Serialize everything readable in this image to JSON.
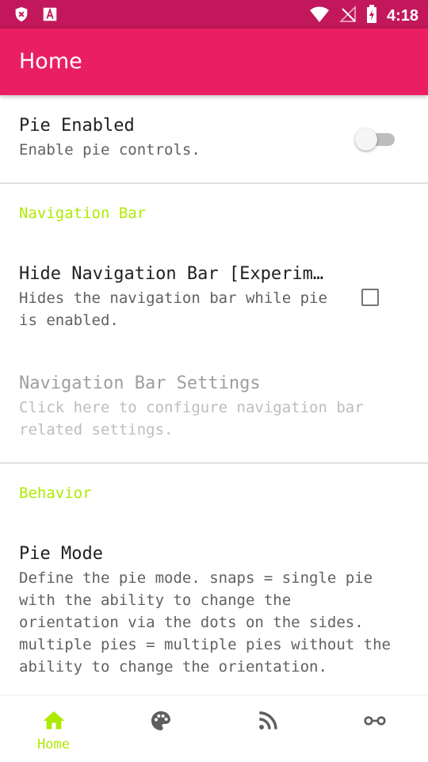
{
  "status_bar": {
    "time": "4:18",
    "left_icons": [
      "shield-x-icon",
      "a-box-icon"
    ],
    "right_icons": [
      "wifi-icon",
      "no-signal-icon",
      "battery-charging-icon"
    ]
  },
  "app_bar": {
    "title": "Home"
  },
  "preferences": {
    "pie_enabled": {
      "title": "Pie Enabled",
      "summary": "Enable pie controls.",
      "checked": false
    },
    "navigation_category": "Navigation Bar",
    "hide_nav_bar": {
      "title": "Hide Navigation Bar [Experimental]",
      "summary": "Hides the navigation bar while pie is enabled.",
      "checked": false
    },
    "nav_bar_settings": {
      "title": "Navigation Bar Settings",
      "summary": "Click here to configure navigation bar related settings.",
      "enabled": false
    },
    "behavior_category": "Behavior",
    "pie_mode": {
      "title": "Pie Mode",
      "summary": "Define the pie mode. snaps = single pie with the ability to change the orientation via the dots on the sides. multiple pies = multiple pies without the ability to change the orientation."
    }
  },
  "bottom_nav": {
    "items": [
      {
        "label": "Home",
        "icon": "home-icon",
        "selected": true
      },
      {
        "label": "",
        "icon": "palette-icon",
        "selected": false
      },
      {
        "label": "",
        "icon": "rss-icon",
        "selected": false
      },
      {
        "label": "",
        "icon": "more-icon",
        "selected": false
      }
    ]
  },
  "colors": {
    "status_bar": "#c2185b",
    "app_bar": "#e91e63",
    "accent": "#aeea00",
    "divider": "#e0e0e0"
  }
}
